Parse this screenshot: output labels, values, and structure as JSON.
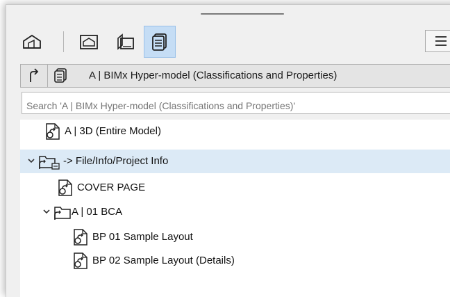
{
  "toolbar": {
    "buttons": [
      {
        "icon": "project-map-icon",
        "active": false
      },
      {
        "icon": "view-map-icon",
        "active": false
      },
      {
        "icon": "layout-book-icon",
        "active": false
      },
      {
        "icon": "publisher-sets-icon",
        "active": true
      }
    ],
    "menu_icon": "hamburger-menu-icon"
  },
  "path_bar": {
    "up_icon": "go-up-icon",
    "set_icon": "publisher-set-icon",
    "title": "A | BIMx Hyper-model (Classifications and Properties)"
  },
  "search": {
    "placeholder": "Search 'A | BIMx Hyper-model (Classifications and Properties)'"
  },
  "tree": {
    "items": [
      {
        "label": "A |  3D (Entire Model)",
        "icon": "view-document-icon",
        "level": 1,
        "expanded": null,
        "selected": false
      },
      {
        "label": "-> File/Info/Project Info",
        "icon": "linked-folder-icon",
        "level": 0,
        "expanded": true,
        "selected": true
      },
      {
        "label": "COVER PAGE",
        "icon": "view-document-icon",
        "level": 1,
        "expanded": null,
        "selected": false
      },
      {
        "label": "A | 01 BCA",
        "icon": "linked-folder-icon",
        "level": 0,
        "expanded": true,
        "selected": false
      },
      {
        "label": "BP 01 Sample Layout",
        "icon": "view-document-icon",
        "level": 2,
        "expanded": null,
        "selected": false
      },
      {
        "label": "BP 02 Sample Layout (Details)",
        "icon": "view-document-icon",
        "level": 2,
        "expanded": null,
        "selected": false
      }
    ]
  },
  "colors": {
    "selection": "#dceaf6",
    "active_button": "#c5ddf5",
    "panel_bg": "#f0f0f0"
  }
}
